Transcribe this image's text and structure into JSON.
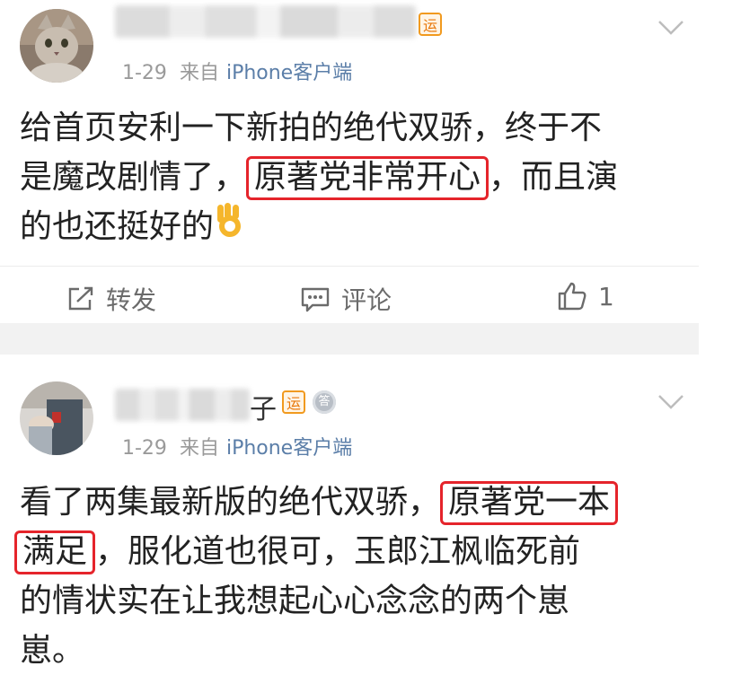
{
  "posts": [
    {
      "name_tail": "",
      "badge": "运",
      "time": "1-29",
      "source_prefix": "来自",
      "client": "iPhone客户端",
      "lines": [
        [
          "给首页安利一下新拍的绝代双骄，终于不"
        ],
        [
          "是魔改剧情了，",
          "原著党非常开心",
          "，而且演"
        ],
        [
          "的也还挺好的"
        ]
      ],
      "actions": {
        "repost": "转发",
        "comment": "评论",
        "like_count": "1"
      }
    },
    {
      "name_tail": "子",
      "badge": "运",
      "medal": "答",
      "time": "1-29",
      "source_prefix": "来自",
      "client": "iPhone客户端",
      "lines": [
        [
          "看了两集最新版的绝代双骄，",
          "原著党一本"
        ],
        [
          "满足",
          "，服化道也很可，玉郎江枫临死前"
        ],
        [
          "的情状实在让我想起心心念念的两个崽"
        ],
        [
          "崽。"
        ]
      ]
    }
  ],
  "colors": {
    "highlight_border": "#e5242b",
    "client_link": "#5b7ea8",
    "badge": "#f19a1f"
  },
  "icons": [
    "chevron-down-icon",
    "repost-icon",
    "comment-icon",
    "like-icon",
    "ok-hand-emoji"
  ]
}
